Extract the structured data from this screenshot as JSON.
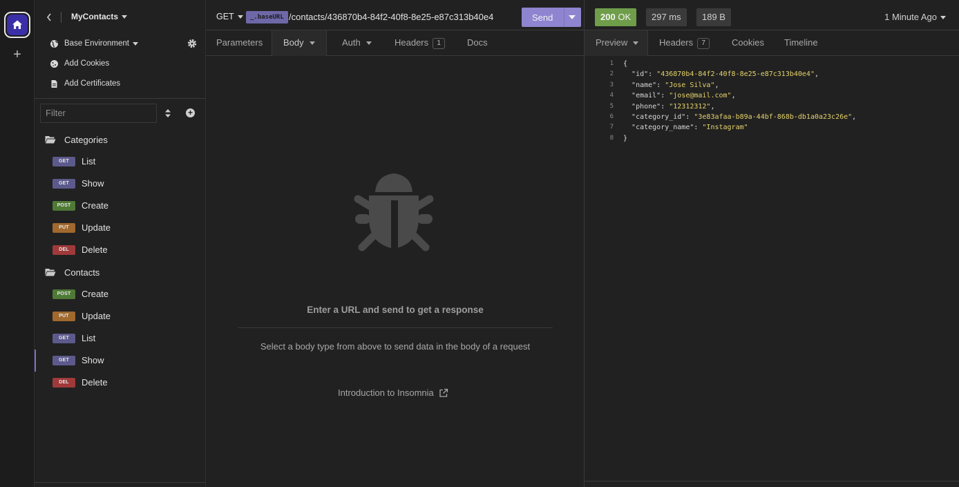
{
  "colors": {
    "accent": "#8f84d0",
    "get": "#5c5a8c",
    "post": "#4f7a36",
    "put": "#a0692e",
    "del": "#a03a3a",
    "ok": "#6f9d4a"
  },
  "sidebar": {
    "project_name": "MyContacts",
    "environment": "Base Environment",
    "add_cookies": "Add Cookies",
    "add_certificates": "Add Certificates",
    "filter_placeholder": "Filter",
    "folders": [
      {
        "name": "Categories",
        "requests": [
          {
            "method": "GET",
            "label": "List"
          },
          {
            "method": "GET",
            "label": "Show"
          },
          {
            "method": "POST",
            "label": "Create"
          },
          {
            "method": "PUT",
            "label": "Update"
          },
          {
            "method": "DEL",
            "label": "Delete"
          }
        ]
      },
      {
        "name": "Contacts",
        "requests": [
          {
            "method": "POST",
            "label": "Create"
          },
          {
            "method": "PUT",
            "label": "Update"
          },
          {
            "method": "GET",
            "label": "List"
          },
          {
            "method": "GET",
            "label": "Show",
            "active": true
          },
          {
            "method": "DEL",
            "label": "Delete"
          }
        ]
      }
    ]
  },
  "request": {
    "method": "GET",
    "base_url_tag": "_.baseURL",
    "path": "/contacts/436870b4-84f2-40f8-8e25-e87c313b40e4",
    "send_label": "Send",
    "tabs": {
      "parameters": "Parameters",
      "body": "Body",
      "auth": "Auth",
      "headers": "Headers",
      "headers_count": "1",
      "docs": "Docs"
    },
    "empty_title": "Enter a URL and send to get a response",
    "empty_subtitle": "Select a body type from above to send data in the body of a request",
    "intro_link": "Introduction to Insomnia"
  },
  "response": {
    "status_code": "200",
    "status_text": "OK",
    "time": "297 ms",
    "size": "189 B",
    "ago": "1 Minute Ago",
    "tabs": {
      "preview": "Preview",
      "headers": "Headers",
      "headers_count": "7",
      "cookies": "Cookies",
      "timeline": "Timeline"
    },
    "body_lines": [
      {
        "n": "1",
        "text": "{"
      },
      {
        "n": "2",
        "key": "\"id\"",
        "val": "\"436870b4-84f2-40f8-8e25-e87c313b40e4\"",
        "tail": ","
      },
      {
        "n": "3",
        "key": "\"name\"",
        "val": "\"Jose Silva\"",
        "tail": ","
      },
      {
        "n": "4",
        "key": "\"email\"",
        "val": "\"jose@mail.com\"",
        "tail": ","
      },
      {
        "n": "5",
        "key": "\"phone\"",
        "val": "\"12312312\"",
        "tail": ","
      },
      {
        "n": "6",
        "key": "\"category_id\"",
        "val": "\"3e83afaa-b89a-44bf-868b-db1a0a23c26e\"",
        "tail": ","
      },
      {
        "n": "7",
        "key": "\"category_name\"",
        "val": "\"Instagram\"",
        "tail": ""
      },
      {
        "n": "8",
        "text": "}"
      }
    ]
  }
}
